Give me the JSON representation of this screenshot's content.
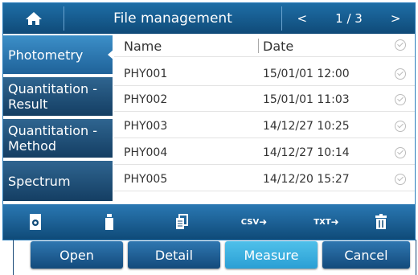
{
  "header": {
    "home_icon": "home-icon",
    "title": "File management",
    "prev": "<",
    "page": "1 / 3",
    "next": ">"
  },
  "sidebar": {
    "items": [
      {
        "label": "Photometry",
        "active": true
      },
      {
        "label": "Quantitation - Result",
        "active": false
      },
      {
        "label": "Quantitation - Method",
        "active": false
      },
      {
        "label": "Spectrum",
        "active": false
      }
    ]
  },
  "table": {
    "columns": [
      "Name",
      "Date"
    ],
    "rows": [
      {
        "name": "PHY001",
        "date": "15/01/01 12:00"
      },
      {
        "name": "PHY002",
        "date": "15/01/01 11:03"
      },
      {
        "name": "PHY003",
        "date": "14/12/27 10:25"
      },
      {
        "name": "PHY004",
        "date": "14/12/27 10:14"
      },
      {
        "name": "PHY005",
        "date": "14/12/20 15:27"
      }
    ]
  },
  "toolbar": {
    "items": [
      {
        "icon": "sd-card-icon"
      },
      {
        "icon": "usb-drive-icon"
      },
      {
        "icon": "copy-icon"
      },
      {
        "icon": "export-csv-icon",
        "label": "CSV"
      },
      {
        "icon": "export-txt-icon",
        "label": "TXT"
      },
      {
        "icon": "trash-icon"
      }
    ]
  },
  "actions": {
    "open": "Open",
    "detail": "Detail",
    "measure": "Measure",
    "cancel": "Cancel"
  },
  "colors": {
    "bar": "#0f4a78",
    "accent": "#3fb4e4",
    "tab_active": "#3c8fc8"
  }
}
